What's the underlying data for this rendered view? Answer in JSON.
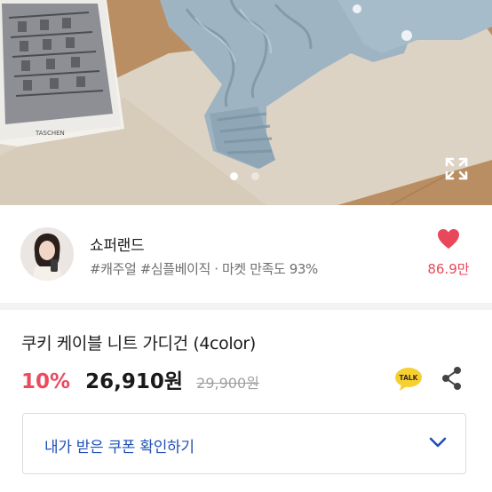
{
  "hero": {
    "book_text": "TASCHEN",
    "image_count": 2,
    "active_index": 1,
    "colors": {
      "sweater": "#9eb4c2",
      "sweater_shadow": "#7c94a4",
      "floor": "#b98e62",
      "rug": "#ddd3c4"
    }
  },
  "seller": {
    "name": "쇼퍼랜드",
    "tags": "#캐주얼 #심플베이직",
    "separator": "·",
    "satisfaction": "마켓 만족도 93%",
    "likes": "86.9만"
  },
  "product": {
    "title": "쿠키 케이블 니트 가디건 (4color)",
    "discount": "10%",
    "price": "26,910원",
    "original_price": "29,900원"
  },
  "actions": {
    "talk_label": "TALK"
  },
  "coupon": {
    "label": "내가 받은 쿠폰 확인하기"
  },
  "colors": {
    "accent_red": "#ea4b5e",
    "link_blue": "#1f4fb5",
    "talk_yellow": "#f5d130",
    "heart": "#e8485a"
  }
}
